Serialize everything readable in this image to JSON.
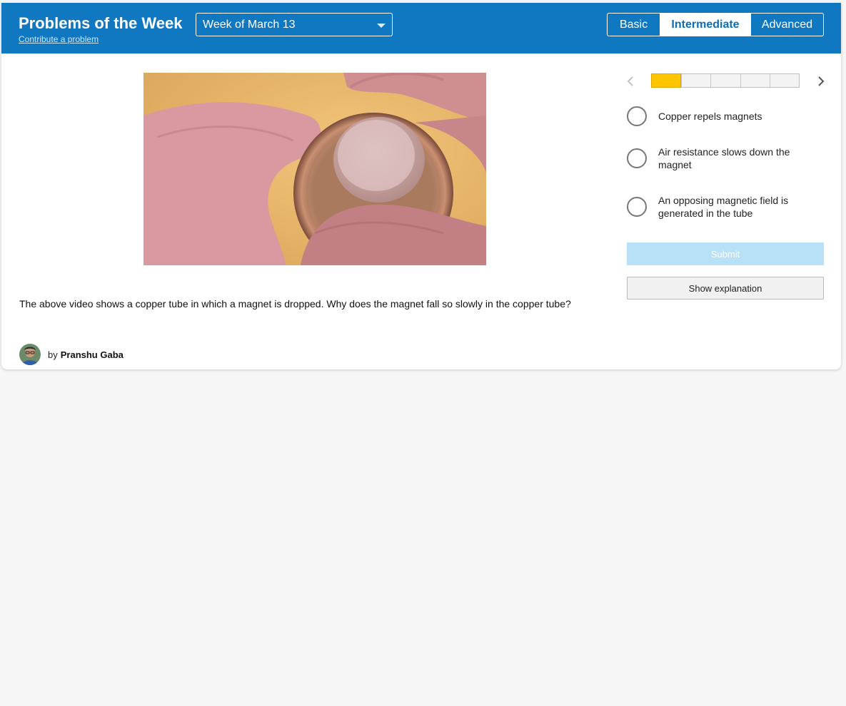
{
  "header": {
    "title": "Problems of the Week",
    "contribute_link": "Contribute a problem",
    "week_select": {
      "value": "Week of March 13"
    },
    "levels": [
      {
        "label": "Basic",
        "active": false
      },
      {
        "label": "Intermediate",
        "active": true
      },
      {
        "label": "Advanced",
        "active": false
      }
    ]
  },
  "problem": {
    "media_icon": "copper-tube-magnet-video",
    "question": "The above video shows a copper tube in which a magnet is dropped. Why does the magnet fall so slowly in the copper tube?",
    "author": {
      "by_label": "by",
      "name": "Pranshu Gaba"
    }
  },
  "navigator": {
    "total_problems": 5,
    "current_problem": 1
  },
  "options": [
    {
      "label": "Copper repels magnets",
      "selected": false
    },
    {
      "label": "Air resistance slows down the magnet",
      "selected": false
    },
    {
      "label": "An opposing magnetic field is generated in the tube",
      "selected": false
    }
  ],
  "actions": {
    "submit_label": "Submit",
    "explanation_label": "Show explanation"
  },
  "colors": {
    "header": "#0f78c0",
    "progress_current": "#ffc600",
    "submit_disabled": "#b8e0f6",
    "page_background": "#f6f6f6"
  }
}
